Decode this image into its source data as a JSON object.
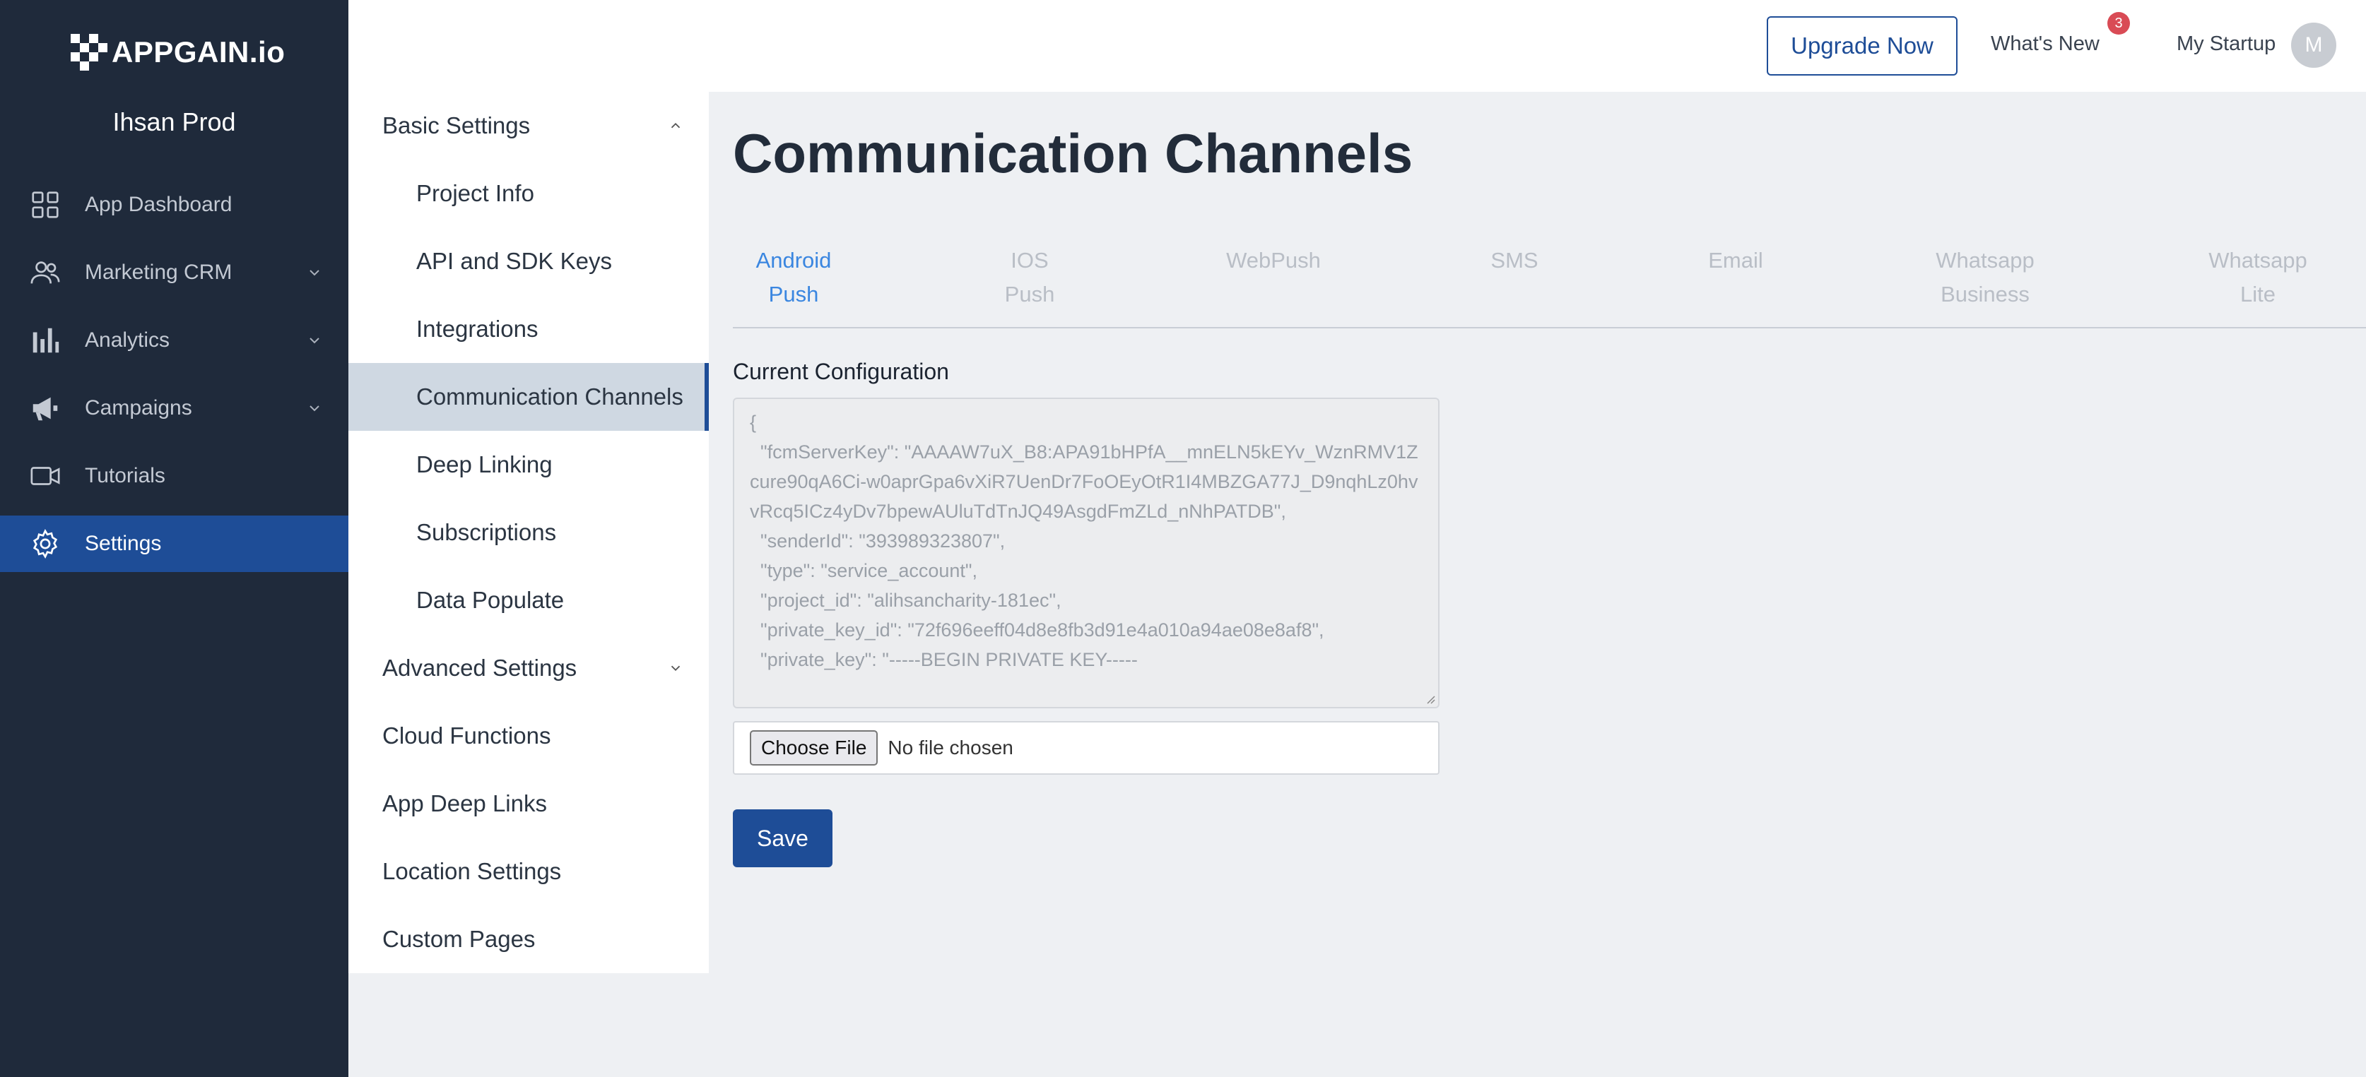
{
  "brand": {
    "logo_text": "APPGAIN.io",
    "project_name": "Ihsan Prod"
  },
  "sidebar": {
    "items": [
      {
        "label": "App Dashboard",
        "icon": "grid-icon",
        "has_chevron": false
      },
      {
        "label": "Marketing CRM",
        "icon": "users-icon",
        "has_chevron": true
      },
      {
        "label": "Analytics",
        "icon": "bar-chart-icon",
        "has_chevron": true
      },
      {
        "label": "Campaigns",
        "icon": "megaphone-icon",
        "has_chevron": true
      },
      {
        "label": "Tutorials",
        "icon": "video-icon",
        "has_chevron": false
      },
      {
        "label": "Settings",
        "icon": "gear-icon",
        "has_chevron": false,
        "active": true
      }
    ]
  },
  "submenu": {
    "basic_settings": "Basic Settings",
    "items": [
      "Project Info",
      "API and SDK Keys",
      "Integrations",
      "Communication Channels",
      "Deep Linking",
      "Subscriptions",
      "Data Populate"
    ],
    "active_item": "Communication Channels",
    "advanced_settings": "Advanced Settings",
    "groups": [
      "Cloud Functions",
      "App Deep Links",
      "Location Settings",
      "Custom Pages"
    ]
  },
  "topbar": {
    "upgrade_label": "Upgrade Now",
    "whats_new_label": "What's New",
    "whats_new_count": "3",
    "workspace_label": "My Startup",
    "avatar_initial": "M"
  },
  "main": {
    "title": "Communication Channels",
    "tabs": [
      "Android\nPush",
      "IOS\nPush",
      "WebPush",
      "SMS",
      "Email",
      "Whatsapp\nBusiness",
      "Whatsapp\nLite"
    ],
    "active_tab": "Android\nPush",
    "config_label": "Current Configuration",
    "config_text": "{\n  \"fcmServerKey\": \"AAAAW7uX_B8:APA91bHPfA__mnELN5kEYv_WznRMV1Zcure90qA6Ci-w0aprGpa6vXiR7UenDr7FoOEyOtR1I4MBZGA77J_D9nqhLz0hvvRcq5ICz4yDv7bpewAUluTdTnJQ49AsgdFmZLd_nNhPATDB\",\n  \"senderId\": \"393989323807\",\n  \"type\": \"service_account\",\n  \"project_id\": \"alihsancharity-181ec\",\n  \"private_key_id\": \"72f696eeff04d8e8fb3d91e4a010a94ae08e8af8\",\n  \"private_key\": \"-----BEGIN PRIVATE KEY-----",
    "choose_file_label": "Choose File",
    "no_file_label": "No file chosen",
    "save_label": "Save"
  },
  "colors": {
    "sidebar_bg": "#1f2a3b",
    "accent": "#1e4d97",
    "active_tab": "#3a86e0",
    "badge": "#d94b55"
  }
}
